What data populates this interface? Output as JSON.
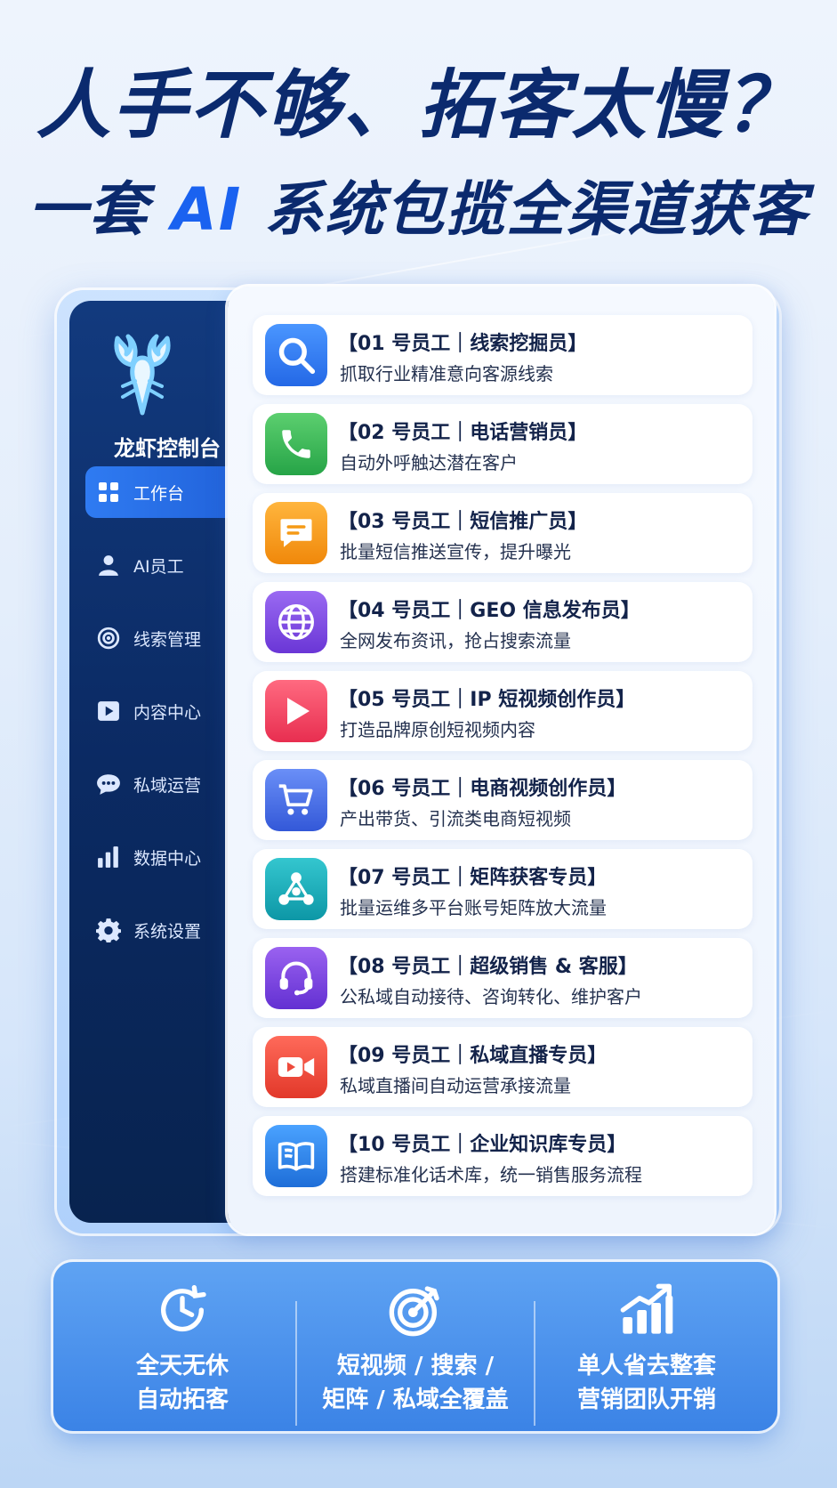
{
  "headline": {
    "line1": "人手不够、拓客太慢？",
    "line2_pre": "一套 ",
    "line2_ai": "AI",
    "line2_post": " 系统包揽全渠道获客"
  },
  "sidebar": {
    "app_name": "龙虾控制台",
    "items": [
      {
        "label": "工作台",
        "icon": "grid-icon",
        "active": true
      },
      {
        "label": "AI员工",
        "icon": "person-icon",
        "active": false
      },
      {
        "label": "线索管理",
        "icon": "target-icon",
        "active": false
      },
      {
        "label": "内容中心",
        "icon": "play-icon",
        "active": false
      },
      {
        "label": "私域运营",
        "icon": "chat-icon",
        "active": false
      },
      {
        "label": "数据中心",
        "icon": "bar-chart-icon",
        "active": false
      },
      {
        "label": "系统设置",
        "icon": "gear-icon",
        "active": false
      }
    ]
  },
  "employees": [
    {
      "title": "【01 号员工｜线索挖掘员】",
      "desc": "抓取行业精准意向客源线索",
      "icon": "search-icon",
      "color": "#2f7cf0"
    },
    {
      "title": "【02 号员工｜电话营销员】",
      "desc": "自动外呼触达潜在客户",
      "icon": "phone-icon",
      "color": "#34b85a"
    },
    {
      "title": "【03 号员工｜短信推广员】",
      "desc": "批量短信推送宣传，提升曝光",
      "icon": "message-icon",
      "color": "#f59a16"
    },
    {
      "title": "【04 号员工｜GEO 信息发布员】",
      "desc": "全网发布资讯，抢占搜索流量",
      "icon": "globe-icon",
      "color": "#7c4be0"
    },
    {
      "title": "【05 号员工｜IP 短视频创作员】",
      "desc": "打造品牌原创短视频内容",
      "icon": "play-icon",
      "color": "#ee3f5e"
    },
    {
      "title": "【06 号员工｜电商视频创作员】",
      "desc": "产出带货、引流类电商短视频",
      "icon": "cart-icon",
      "color": "#3f6be6"
    },
    {
      "title": "【07 号员工｜矩阵获客专员】",
      "desc": "批量运维多平台账号矩阵放大流量",
      "icon": "network-icon",
      "color": "#14a6b4"
    },
    {
      "title": "【08 号员工｜超级销售 & 客服】",
      "desc": "公私域自动接待、咨询转化、维护客户",
      "icon": "headset-icon",
      "color": "#7a46dc"
    },
    {
      "title": "【09 号员工｜私域直播专员】",
      "desc": "私域直播间自动运营承接流量",
      "icon": "video-icon",
      "color": "#ee4a3c"
    },
    {
      "title": "【10 号员工｜企业知识库专员】",
      "desc": "搭建标准化话术库，统一销售服务流程",
      "icon": "book-icon",
      "color": "#2d86e6"
    }
  ],
  "features": [
    {
      "line1": "全天无休",
      "line2": "自动拓客",
      "icon": "clock-icon"
    },
    {
      "line1": "短视频 / 搜索 /",
      "line2": "矩阵 / 私域全覆盖",
      "icon": "target-icon"
    },
    {
      "line1": "单人省去整套",
      "line2": "营销团队开销",
      "icon": "growth-chart-icon"
    }
  ]
}
